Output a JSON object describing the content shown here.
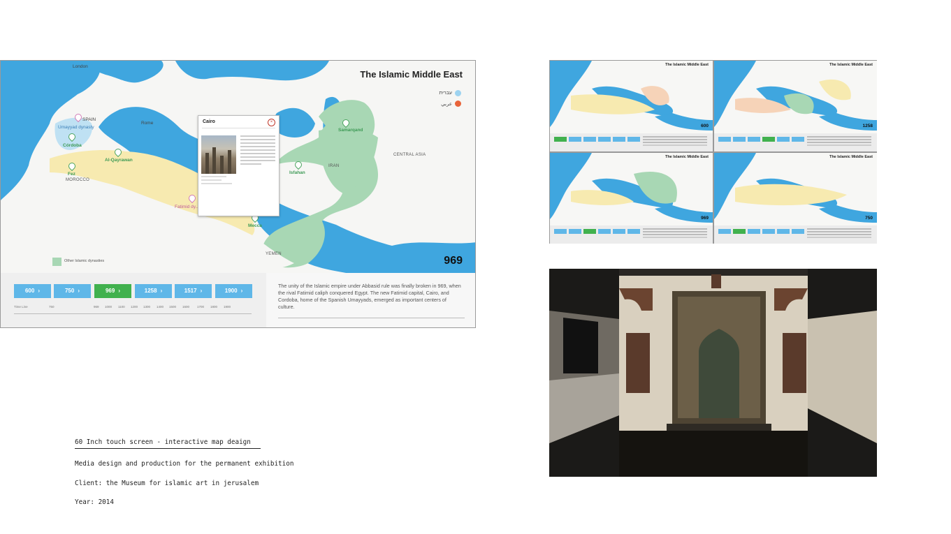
{
  "main_map": {
    "title": "The Islamic Middle East",
    "lang_hebrew": "עברית",
    "lang_arabic": "عربي",
    "year": "969",
    "places": {
      "london": "London",
      "spain": "SPAIN",
      "umayyad": "Umayyad dynasty",
      "cordoba": "Córdoba",
      "rome": "Rome",
      "fez": "Fez",
      "morocco": "MOROCCO",
      "qayrawan": "Al-Qayrawan",
      "fatimid": "Fatimid dy...",
      "samarqand": "Samarqand",
      "central_asia": "CENTRAL ASIA",
      "iran": "IRAN",
      "isfahan": "Isfahan",
      "mecca": "Mecca",
      "yemen": "YEMEN"
    },
    "legend_label": "Other Islamic dynasties",
    "popup": {
      "title": "Cairo",
      "close_icon": "close-icon"
    }
  },
  "timeline": {
    "buttons": [
      "600",
      "750",
      "969",
      "1258",
      "1517",
      "1900"
    ],
    "active": "969",
    "time_line_label": "Time Line",
    "ticks": [
      "750",
      "",
      "",
      "",
      "969",
      "1000",
      "1100",
      "1200",
      "1300",
      "1400",
      "1500",
      "1600",
      "1700",
      "1800",
      "1900"
    ]
  },
  "description": "The unity of the Islamic empire under Abbasid rule was finally broken in 969, when the rival Fatimid caliph conquered Egypt. The new Fatimid capital, Cairo, and Cordoba, home of the Spanish Umayyads, emerged as important centers of culture.",
  "thumbnails": [
    {
      "title": "The Islamic Middle East",
      "year": "600",
      "active_index": 0
    },
    {
      "title": "The Islamic Middle East",
      "year": "1258",
      "active_index": 3
    },
    {
      "title": "The Islamic Middle East",
      "year": "969",
      "active_index": 2
    },
    {
      "title": "The Islamic Middle East",
      "year": "750",
      "active_index": 1
    }
  ],
  "caption": {
    "heading": "60 Inch touch screen - interactive map deaign",
    "media": "Media design and production for the permanent exhibition",
    "client": "Client: the Museum for islamic art in jerusalem",
    "year": "Year: 2014"
  },
  "colors": {
    "sea": "#3fa6df",
    "land": "#f6f6f4",
    "fatimid": "#f7eab0",
    "abbasid": "#a8d7b4",
    "umayyad": "#bfe1f3",
    "button": "#5fb7e8",
    "button_active": "#41b14e"
  }
}
